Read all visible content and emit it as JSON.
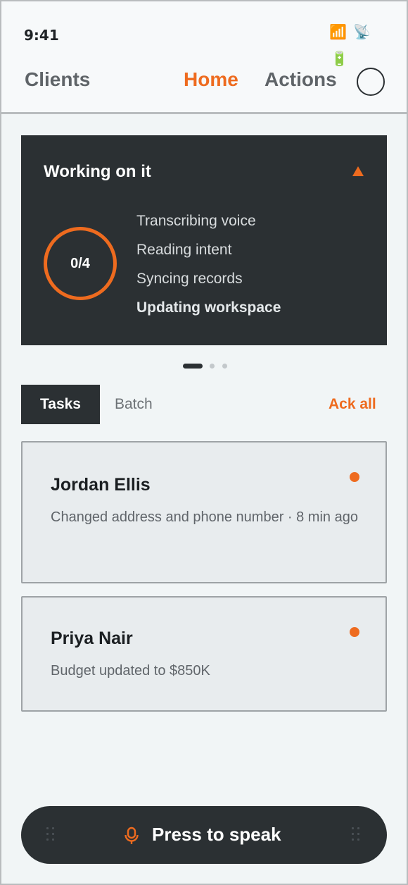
{
  "status_bar": {
    "time": "9:41",
    "signal_icon": "📶",
    "satellite_icon": "📡",
    "battery_icon": "🔋"
  },
  "nav": {
    "clients": "Clients",
    "home": "Home",
    "actions": "Actions",
    "active_tab": "Home"
  },
  "progress_card": {
    "title": "Working on it",
    "counter": "0/4",
    "progress_fraction": 0,
    "steps": [
      {
        "label": "Transcribing voice",
        "active": false
      },
      {
        "label": "Reading intent",
        "active": false
      },
      {
        "label": "Syncing records",
        "active": false
      },
      {
        "label": "Updating workspace",
        "active": true
      }
    ]
  },
  "pager": {
    "pages": 3,
    "current": 1
  },
  "tabs": {
    "tasks": "Tasks",
    "batch": "Batch",
    "ack_all": "Ack all",
    "selected": "Tasks"
  },
  "tasks": [
    {
      "name": "Jordan Ellis",
      "description": "Changed address and phone number · 8 min ago",
      "unread": true
    },
    {
      "name": "Priya Nair",
      "description": "Budget updated to $850K",
      "unread": true
    }
  ],
  "speak": {
    "label": "Press to speak"
  },
  "colors": {
    "accent": "#ee6b1f",
    "dark": "#2b3033",
    "background": "#f1f5f6",
    "card": "#e8ecee"
  }
}
